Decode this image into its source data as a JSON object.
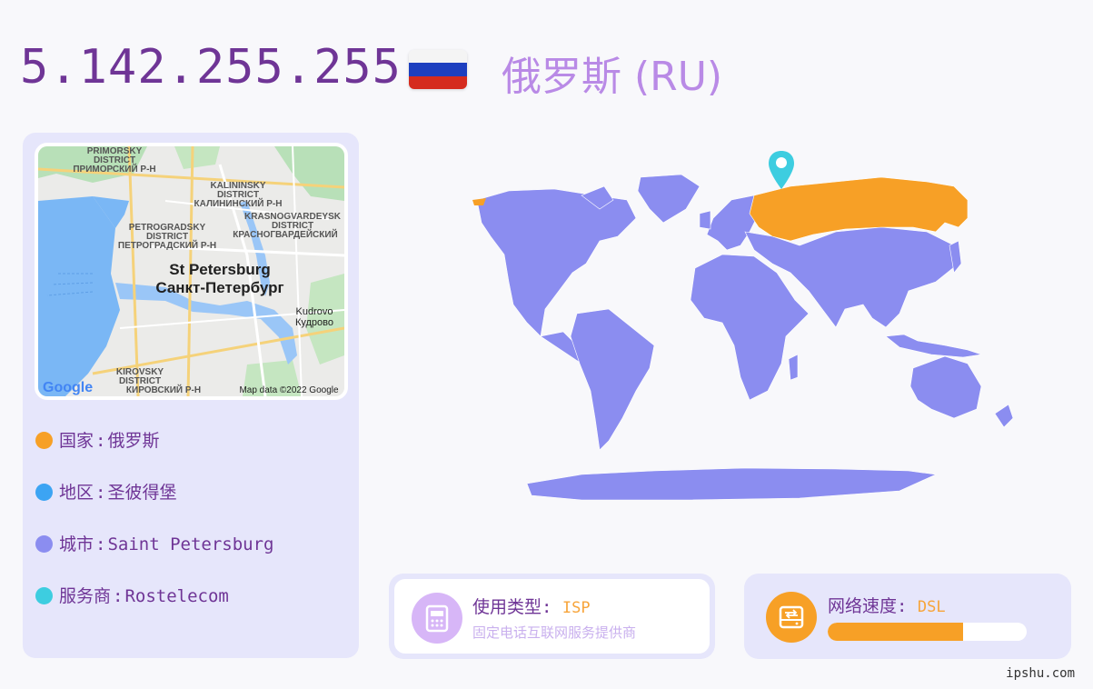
{
  "header": {
    "ip": "5.142.255.255",
    "country_title": "俄罗斯 (RU)",
    "flag_colors": [
      "#ffffff",
      "#1d3fbf",
      "#d52b1e"
    ]
  },
  "map": {
    "city_en": "St Petersburg",
    "city_ru": "Санкт-Петербург",
    "districts": [
      {
        "en": "PRIMORSKY",
        "en2": "DISTRICT",
        "ru": "ПРИМОРСКИЙ Р-Н"
      },
      {
        "en": "KALININSKY",
        "en2": "DISTRICT",
        "ru": "КАЛИНИНСКИЙ Р-Н"
      },
      {
        "en": "KRASNOGVARDEYSK",
        "en2": "DISTRICT",
        "ru": "КРАСНОГВАРДЕЙСКИЙ"
      },
      {
        "en": "PETROGRADSKY",
        "en2": "DISTRICT",
        "ru": "ПЕТРОГРАДСКИЙ Р-Н"
      },
      {
        "en": "KIROVSKY",
        "en2": "DISTRICT",
        "ru": "КИРОВСКИЙ Р-Н"
      }
    ],
    "kudrovo_en": "Kudrovo",
    "kudrovo_ru": "Кудрово",
    "logo": "Google",
    "attribution": "Map data ©2022 Google"
  },
  "info": {
    "items": [
      {
        "label": "国家",
        "value": "俄罗斯",
        "color": "#f7a026"
      },
      {
        "label": "地区",
        "value": "圣彼得堡",
        "color": "#3ca4f3"
      },
      {
        "label": "城市",
        "value": "Saint Petersburg",
        "color": "#8b8df0"
      },
      {
        "label": "服务商",
        "value": "Rostelecom",
        "color": "#3dcde0"
      }
    ],
    "separator": ":"
  },
  "usage": {
    "label": "使用类型",
    "value": "ISP",
    "desc": "固定电话互联网服务提供商",
    "icon": "phone-icon",
    "icon_color": "#d7b6f7"
  },
  "speed": {
    "label": "网络速度",
    "value": "DSL",
    "level_percent": 68,
    "icon": "router-icon",
    "icon_color": "#f7a026"
  },
  "world": {
    "land_color": "#8b8df0",
    "highlight_color": "#f7a026",
    "pin_color": "#3dcde0"
  },
  "footer": {
    "site": "ipshu.com"
  }
}
